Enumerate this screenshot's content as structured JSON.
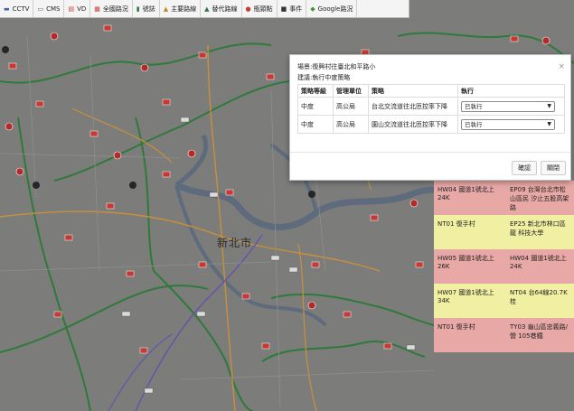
{
  "toolbar": {
    "items": [
      {
        "label": "CCTV",
        "icon": "camera-icon"
      },
      {
        "label": "CMS",
        "icon": "sign-icon"
      },
      {
        "label": "VD",
        "icon": "detector-icon"
      },
      {
        "label": "全國路況",
        "icon": "traffic-icon"
      },
      {
        "label": "號誌",
        "icon": "traffic-light-icon"
      },
      {
        "label": "主要路線",
        "icon": "main-route-icon"
      },
      {
        "label": "替代路線",
        "icon": "alt-route-icon"
      },
      {
        "label": "瓶頸點",
        "icon": "bottleneck-icon"
      },
      {
        "label": "事件",
        "icon": "incident-icon"
      },
      {
        "label": "Google路況",
        "icon": "google-traffic-icon"
      }
    ]
  },
  "map": {
    "city_label": "新北市"
  },
  "modal": {
    "line1": "場景:復興村往臺北和平路小",
    "line2": "建議:執行中度策略",
    "headers": [
      "策略等級",
      "管理單位",
      "策略",
      "執行"
    ],
    "rows": [
      {
        "level": "中度",
        "unit": "高公局",
        "strategy": "台北交流道往北匝控率下降",
        "action": "已執行"
      },
      {
        "level": "中度",
        "unit": "高公局",
        "strategy": "園山交流道往北匝控率下降",
        "action": "已執行"
      }
    ],
    "confirm_label": "確認",
    "close_label": "關閉",
    "close_icon": "×"
  },
  "panel": {
    "rows": [
      {
        "left": "HW04 國道1號北上 24K",
        "right": "EP09 台灣台北市松山區民 汐止五股高架路",
        "color": "#e8a8a6"
      },
      {
        "left": "NT01 復手村",
        "right": "EP25 新北市林口區龍 科技大學",
        "color": "#f1f0a2"
      },
      {
        "left": "HW05 國道1號北上 26K",
        "right": "HW04 國道1號北上 24K",
        "color": "#e8a8a6"
      },
      {
        "left": "HW07 國道1號北上 34K",
        "right": "NT04 台64線20.7K桂",
        "color": "#f1f0a2"
      },
      {
        "left": "NT01 復手村",
        "right": "TY03 龜山區忠義路/營 105巷鐵",
        "color": "#e8a8a6"
      }
    ]
  }
}
